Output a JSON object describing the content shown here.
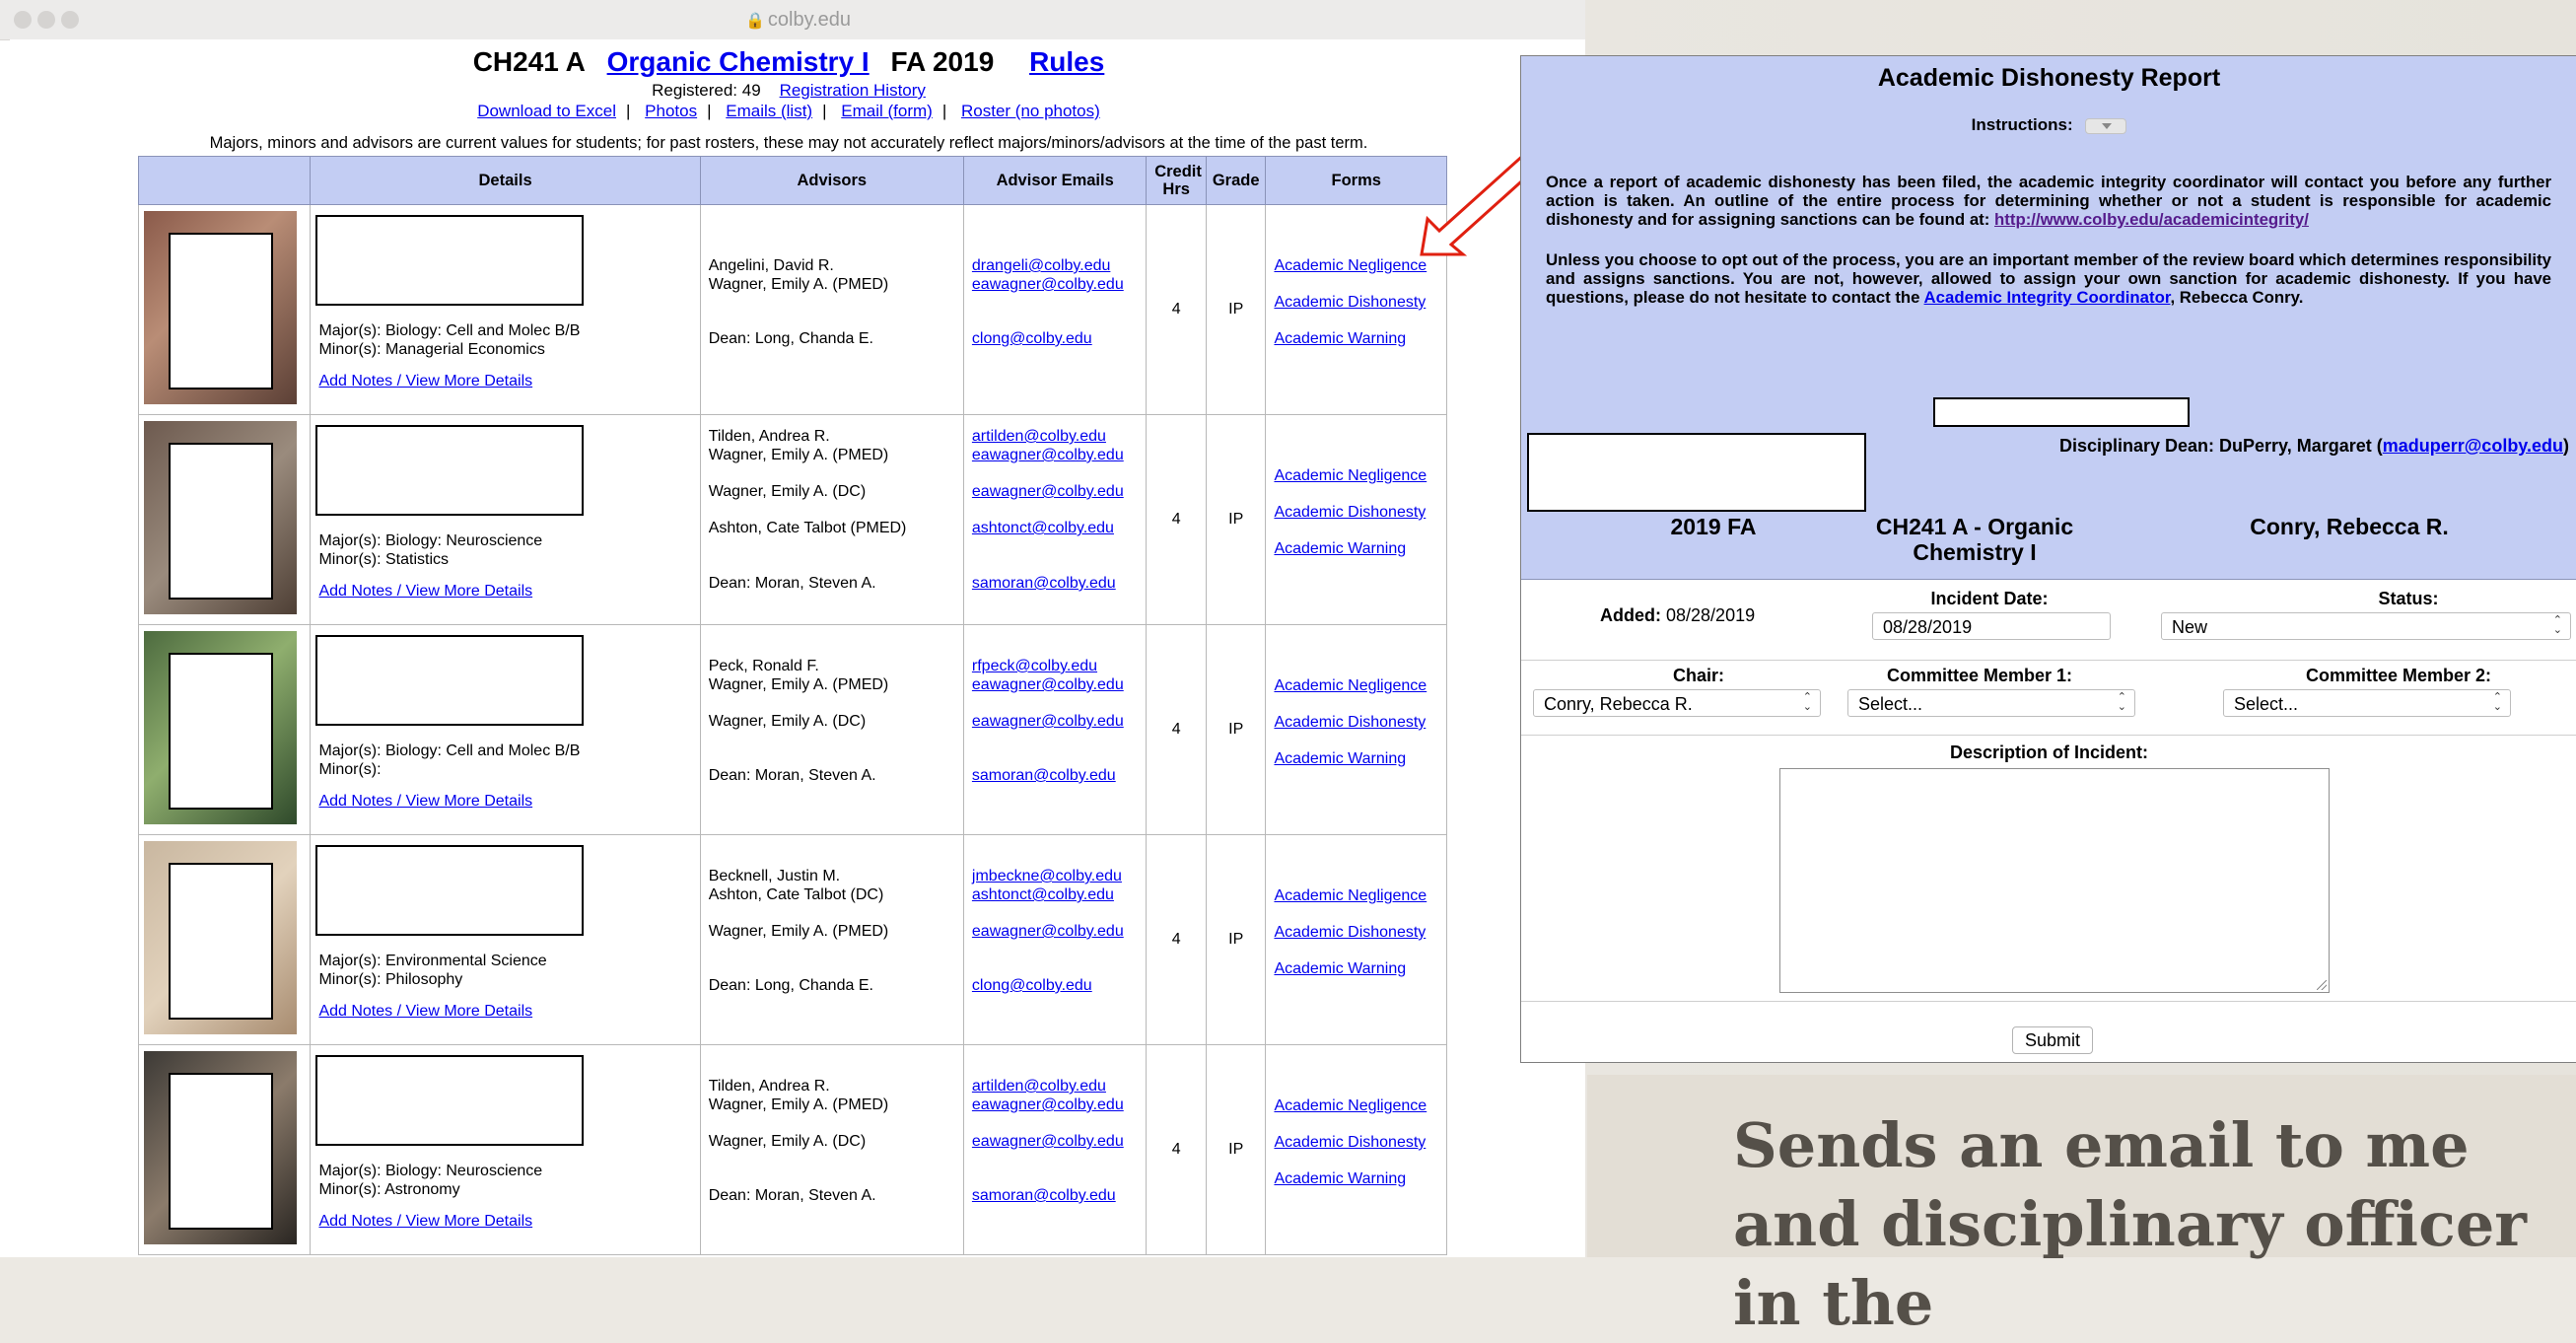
{
  "browser": {
    "url": "colby.edu"
  },
  "header": {
    "course_code": "CH241 A",
    "course_name": "Organic Chemistry I",
    "term": "FA 2019",
    "rules_link": "Rules",
    "registered_label": "Registered: 49",
    "registration_history_link": "Registration History",
    "links": [
      "Download to Excel",
      "Photos",
      "Emails (list)",
      "Email (form)",
      "Roster (no photos)"
    ],
    "note": "Majors, minors and advisors are current values for students; for past rosters, these may not accurately reflect majors/minors/advisors at the time of the past term."
  },
  "table": {
    "columns": [
      "",
      "Details",
      "Advisors",
      "Advisor Emails",
      "Credit Hrs",
      "Grade",
      "Forms"
    ],
    "notes_link": "Add Notes / View More Details",
    "form_links": [
      "Academic Negligence",
      "Academic Dishonesty",
      "Academic Warning"
    ],
    "rows": [
      {
        "majors": "Major(s): Biology: Cell and Molec B/B",
        "minors": "Minor(s): Managerial Economics",
        "advisors": [
          "Angelini, David R.",
          "Wagner, Emily A. (PMED)",
          "Dean: Long, Chanda E."
        ],
        "emails": [
          "drangeli@colby.edu",
          "eawagner@colby.edu",
          "clong@colby.edu"
        ],
        "credit": "4",
        "grade": "IP"
      },
      {
        "majors": "Major(s): Biology: Neuroscience",
        "minors": "Minor(s): Statistics",
        "advisors": [
          "Tilden, Andrea R.",
          "Wagner, Emily A. (PMED)",
          "Wagner, Emily A. (DC)",
          "Ashton, Cate Talbot (PMED)",
          "Dean: Moran, Steven A."
        ],
        "emails": [
          "artilden@colby.edu",
          "eawagner@colby.edu",
          "eawagner@colby.edu",
          "ashtonct@colby.edu",
          "samoran@colby.edu"
        ],
        "credit": "4",
        "grade": "IP"
      },
      {
        "majors": "Major(s): Biology: Cell and Molec B/B",
        "minors": "Minor(s):",
        "advisors": [
          "Peck, Ronald F.",
          "Wagner, Emily A. (PMED)",
          "Wagner, Emily A. (DC)",
          "Dean: Moran, Steven A."
        ],
        "emails": [
          "rfpeck@colby.edu",
          "eawagner@colby.edu",
          "eawagner@colby.edu",
          "samoran@colby.edu"
        ],
        "credit": "4",
        "grade": "IP"
      },
      {
        "majors": "Major(s): Environmental Science",
        "minors": "Minor(s): Philosophy",
        "advisors": [
          "Becknell, Justin M.",
          "Ashton, Cate Talbot (DC)",
          "Wagner, Emily A. (PMED)",
          "Dean: Long, Chanda E."
        ],
        "emails": [
          "jmbeckne@colby.edu",
          "ashtonct@colby.edu",
          "eawagner@colby.edu",
          "clong@colby.edu"
        ],
        "credit": "4",
        "grade": "IP"
      },
      {
        "majors": "Major(s): Biology: Neuroscience",
        "minors": "Minor(s): Astronomy",
        "advisors": [
          "Tilden, Andrea R.",
          "Wagner, Emily A. (PMED)",
          "Wagner, Emily A. (DC)",
          "Dean: Moran, Steven A."
        ],
        "emails": [
          "artilden@colby.edu",
          "eawagner@colby.edu",
          "eawagner@colby.edu",
          "samoran@colby.edu"
        ],
        "credit": "4",
        "grade": "IP"
      }
    ]
  },
  "report": {
    "title": "Academic Dishonesty Report",
    "instructions_label": "Instructions:",
    "para1": "Once a report of academic dishonesty has been filed, the academic integrity coordinator will contact you before any further action is taken. An outline of the entire process for determining whether or not a student is responsible for academic dishonesty and for assigning sanctions can be found at:",
    "para1_link": "http://www.colby.edu/academicintegrity/",
    "para2_a": "Unless you choose to opt out of the process, you are an important member of the review board which determines responsibility and assigns sanctions. You are not, however, allowed to assign your own sanction for academic dishonesty. If you have questions, please do not hesitate to contact the",
    "para2_link": "Academic Integrity Coordinator",
    "para2_b": ", Rebecca Conry.",
    "dean_label": "Disciplinary Dean: DuPerry, Margaret (",
    "dean_email": "maduperr@colby.edu",
    "dean_close": ")",
    "term": "2019 FA",
    "course": "CH241 A - Organic Chemistry I",
    "instructor": "Conry, Rebecca R.",
    "added_label": "Added:",
    "added_value": "08/28/2019",
    "incident_date_label": "Incident Date:",
    "incident_date_value": "08/28/2019",
    "status_label": "Status:",
    "status_value": "New",
    "chair_label": "Chair:",
    "chair_value": "Conry, Rebecca R.",
    "committee1_label": "Committee Member 1:",
    "committee1_value": "Select...",
    "committee2_label": "Committee Member 2:",
    "committee2_value": "Select...",
    "description_label": "Description of Incident:",
    "submit_label": "Submit"
  },
  "caption": "Sends an email to me and disciplinary officer in the",
  "colors": {
    "header_blue": "#c3cdf3",
    "link": "#0000ee",
    "arrow": "#e02010"
  }
}
